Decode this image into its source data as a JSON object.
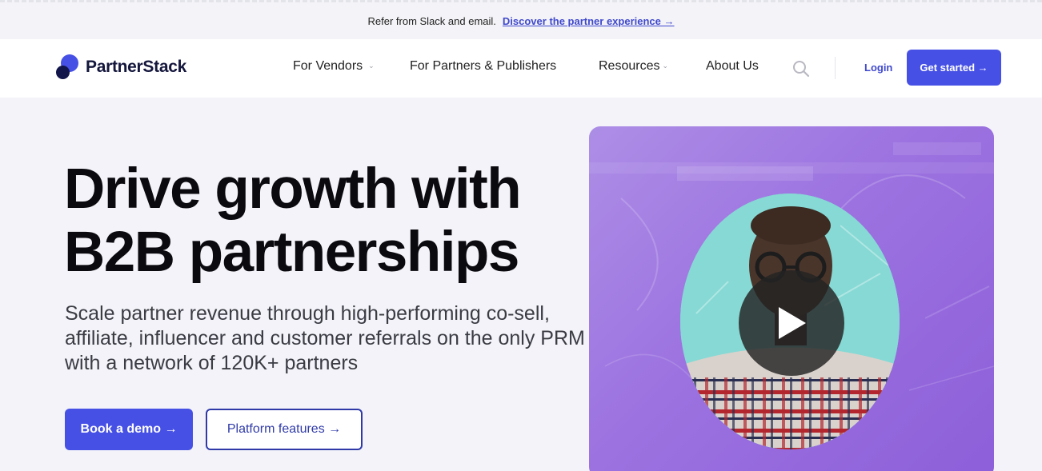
{
  "announcement": {
    "text": "Refer from Slack and email.",
    "link": "Discover the partner experience →"
  },
  "header": {
    "brand": "PartnerStack",
    "nav": [
      {
        "label": "For Vendors",
        "dropdown": true
      },
      {
        "label": "For Partners & Publishers",
        "dropdown": false
      },
      {
        "label": "Resources",
        "dropdown": true
      },
      {
        "label": "About Us",
        "dropdown": false
      }
    ],
    "login": "Login",
    "cta": "Get started →"
  },
  "hero": {
    "title_line1": "Drive growth with",
    "title_line2": "B2B partnerships",
    "subtitle": "Scale partner revenue through high-performing co-sell, affiliate, influencer and customer referrals on the only PRM with a network of 120K+ partners",
    "primary_button": "Book a demo →",
    "secondary_button": "Platform features →"
  },
  "colors": {
    "brand": "#4650e5",
    "link": "#3f48cc",
    "dark": "#12154a",
    "video_bg": "#9c72e0"
  },
  "icons": [
    "logo-mark",
    "chevron-down-icon",
    "search-icon",
    "play-icon"
  ]
}
